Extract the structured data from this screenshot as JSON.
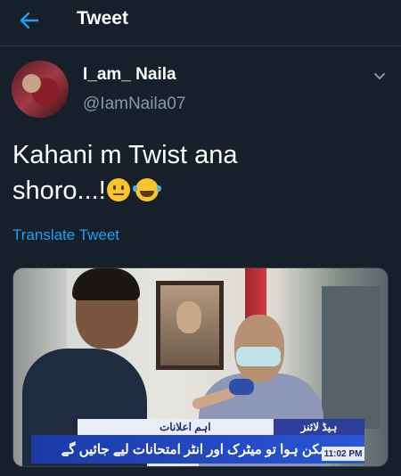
{
  "header": {
    "title": "Tweet"
  },
  "author": {
    "display_name": "I_am_ Naila",
    "handle": "@IamNaila07"
  },
  "tweet": {
    "text_line1": "Kahani m Twist ana",
    "text_line2": "shoro...!"
  },
  "translate_label": "Translate Tweet",
  "media": {
    "ticker_label": "ہیڈ لائنز",
    "ticker_subtitle": "اہم اعلانات",
    "ticker_headline": "ممکن ہوا تو میٹرک اور انٹر امتحانات لیے جائیں گے",
    "ticker_time": "11:02 PM"
  },
  "colors": {
    "background": "#15202b",
    "accent": "#1da1f2",
    "secondary_text": "#8899a6"
  },
  "icons": {
    "back": "arrow-left-icon",
    "more": "chevron-down-icon",
    "emoji1": "neutral-face-emoji",
    "emoji2": "tears-of-joy-emoji"
  }
}
